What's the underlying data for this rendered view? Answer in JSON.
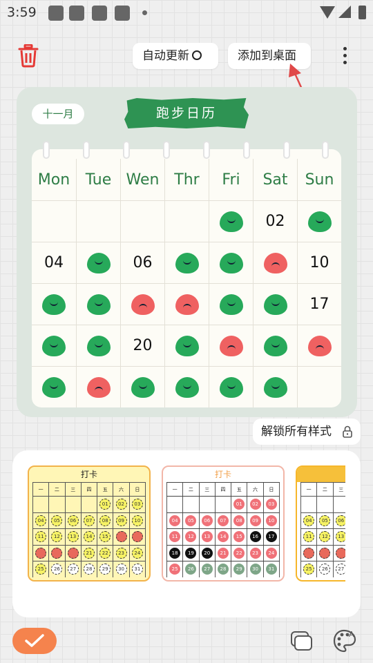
{
  "status_bar": {
    "time": "3:59"
  },
  "toolbar": {
    "auto_update_label": "自动更新",
    "add_to_desktop_label": "添加到桌面"
  },
  "widget": {
    "month_label": "十一月",
    "title": "跑步日历",
    "weekdays": [
      "Mon",
      "Tue",
      "Wen",
      "Thr",
      "Fri",
      "Sat",
      "Sun"
    ],
    "weeks": [
      [
        {
          "type": "empty"
        },
        {
          "type": "empty"
        },
        {
          "type": "empty"
        },
        {
          "type": "empty"
        },
        {
          "type": "green"
        },
        {
          "type": "text",
          "text": "02"
        },
        {
          "type": "green"
        }
      ],
      [
        {
          "type": "text",
          "text": "04"
        },
        {
          "type": "green"
        },
        {
          "type": "text",
          "text": "06"
        },
        {
          "type": "green"
        },
        {
          "type": "green"
        },
        {
          "type": "red"
        },
        {
          "type": "text",
          "text": "10"
        }
      ],
      [
        {
          "type": "green"
        },
        {
          "type": "green"
        },
        {
          "type": "red"
        },
        {
          "type": "red"
        },
        {
          "type": "green"
        },
        {
          "type": "green"
        },
        {
          "type": "text",
          "text": "17"
        }
      ],
      [
        {
          "type": "green"
        },
        {
          "type": "green"
        },
        {
          "type": "text",
          "text": "20"
        },
        {
          "type": "green"
        },
        {
          "type": "red"
        },
        {
          "type": "green"
        },
        {
          "type": "red"
        }
      ],
      [
        {
          "type": "green"
        },
        {
          "type": "red"
        },
        {
          "type": "green"
        },
        {
          "type": "green"
        },
        {
          "type": "green"
        },
        {
          "type": "green"
        },
        {
          "type": "empty"
        }
      ]
    ]
  },
  "unlock_label": "解锁所有样式",
  "styles": {
    "thumb1": {
      "title": "打卡",
      "weekdays": [
        "一",
        "二",
        "三",
        "四",
        "五",
        "六",
        "日"
      ],
      "rows": [
        [
          {
            "t": "",
            "k": "none"
          },
          {
            "t": "",
            "k": "none"
          },
          {
            "t": "",
            "k": "none"
          },
          {
            "t": "",
            "k": "none"
          },
          {
            "t": "01",
            "k": "y"
          },
          {
            "t": "02",
            "k": "y"
          },
          {
            "t": "03",
            "k": "y"
          }
        ],
        [
          {
            "t": "04",
            "k": "y"
          },
          {
            "t": "05",
            "k": "y"
          },
          {
            "t": "06",
            "k": "y"
          },
          {
            "t": "07",
            "k": "y"
          },
          {
            "t": "08",
            "k": "y"
          },
          {
            "t": "09",
            "k": "y"
          },
          {
            "t": "10",
            "k": "y"
          }
        ],
        [
          {
            "t": "11",
            "k": "y"
          },
          {
            "t": "12",
            "k": "y"
          },
          {
            "t": "13",
            "k": "y"
          },
          {
            "t": "14",
            "k": "y"
          },
          {
            "t": "15",
            "k": "y"
          },
          {
            "t": "",
            "k": "red"
          },
          {
            "t": "",
            "k": "red"
          }
        ],
        [
          {
            "t": "",
            "k": "red"
          },
          {
            "t": "",
            "k": "red"
          },
          {
            "t": "",
            "k": "red"
          },
          {
            "t": "21",
            "k": "y"
          },
          {
            "t": "22",
            "k": "y"
          },
          {
            "t": "23",
            "k": "y"
          },
          {
            "t": "24",
            "k": "y"
          }
        ],
        [
          {
            "t": "25",
            "k": "y"
          },
          {
            "t": "26",
            "k": "empty"
          },
          {
            "t": "27",
            "k": "empty"
          },
          {
            "t": "28",
            "k": "empty"
          },
          {
            "t": "29",
            "k": "empty"
          },
          {
            "t": "30",
            "k": "empty"
          },
          {
            "t": "31",
            "k": "empty"
          }
        ]
      ]
    },
    "thumb2": {
      "title": "打卡",
      "weekdays": [
        "一",
        "二",
        "三",
        "四",
        "五",
        "六",
        "日"
      ],
      "rows": [
        [
          {
            "t": "",
            "k": "none"
          },
          {
            "t": "",
            "k": "none"
          },
          {
            "t": "",
            "k": "none"
          },
          {
            "t": "",
            "k": "none"
          },
          {
            "t": "01",
            "k": "pink"
          },
          {
            "t": "02",
            "k": "pink"
          },
          {
            "t": "03",
            "k": "pink"
          }
        ],
        [
          {
            "t": "04",
            "k": "pink"
          },
          {
            "t": "05",
            "k": "pink"
          },
          {
            "t": "06",
            "k": "pink"
          },
          {
            "t": "07",
            "k": "pink"
          },
          {
            "t": "08",
            "k": "pink"
          },
          {
            "t": "09",
            "k": "pink"
          },
          {
            "t": "10",
            "k": "pink"
          }
        ],
        [
          {
            "t": "11",
            "k": "pink"
          },
          {
            "t": "12",
            "k": "pink"
          },
          {
            "t": "13",
            "k": "pink"
          },
          {
            "t": "14",
            "k": "pink"
          },
          {
            "t": "15",
            "k": "pink"
          },
          {
            "t": "16",
            "k": "black"
          },
          {
            "t": "17",
            "k": "black"
          }
        ],
        [
          {
            "t": "18",
            "k": "black"
          },
          {
            "t": "19",
            "k": "black"
          },
          {
            "t": "20",
            "k": "black"
          },
          {
            "t": "21",
            "k": "pink"
          },
          {
            "t": "22",
            "k": "pink"
          },
          {
            "t": "23",
            "k": "pink"
          },
          {
            "t": "24",
            "k": "pink"
          }
        ],
        [
          {
            "t": "25",
            "k": "pink"
          },
          {
            "t": "26",
            "k": "sage"
          },
          {
            "t": "27",
            "k": "sage"
          },
          {
            "t": "28",
            "k": "sage"
          },
          {
            "t": "29",
            "k": "sage"
          },
          {
            "t": "30",
            "k": "sage"
          },
          {
            "t": "31",
            "k": "sage"
          }
        ]
      ]
    },
    "thumb3": {
      "title": "",
      "weekdays": [
        "一",
        "二",
        "三",
        "",
        "",
        "",
        ""
      ],
      "rows": [
        [
          {
            "t": "",
            "k": "none"
          },
          {
            "t": "",
            "k": "none"
          },
          {
            "t": "",
            "k": "none"
          },
          {
            "t": "",
            "k": "none"
          },
          {
            "t": "",
            "k": "none"
          },
          {
            "t": "",
            "k": "none"
          },
          {
            "t": "",
            "k": "none"
          }
        ],
        [
          {
            "t": "04",
            "k": "y"
          },
          {
            "t": "05",
            "k": "y"
          },
          {
            "t": "06",
            "k": "y"
          },
          {
            "t": "",
            "k": "none"
          },
          {
            "t": "",
            "k": "none"
          },
          {
            "t": "",
            "k": "none"
          },
          {
            "t": "",
            "k": "none"
          }
        ],
        [
          {
            "t": "11",
            "k": "y"
          },
          {
            "t": "12",
            "k": "y"
          },
          {
            "t": "13",
            "k": "y"
          },
          {
            "t": "",
            "k": "none"
          },
          {
            "t": "",
            "k": "none"
          },
          {
            "t": "",
            "k": "none"
          },
          {
            "t": "",
            "k": "none"
          }
        ],
        [
          {
            "t": "",
            "k": "red"
          },
          {
            "t": "",
            "k": "red"
          },
          {
            "t": "",
            "k": "red"
          },
          {
            "t": "",
            "k": "none"
          },
          {
            "t": "",
            "k": "none"
          },
          {
            "t": "",
            "k": "none"
          },
          {
            "t": "",
            "k": "none"
          }
        ],
        [
          {
            "t": "25",
            "k": "y"
          },
          {
            "t": "26",
            "k": "empty"
          },
          {
            "t": "27",
            "k": "empty"
          },
          {
            "t": "",
            "k": "none"
          },
          {
            "t": "",
            "k": "none"
          },
          {
            "t": "",
            "k": "none"
          },
          {
            "t": "",
            "k": "none"
          }
        ]
      ]
    }
  },
  "icons": {
    "trash": "trash-icon",
    "more": "more-vertical-icon",
    "lock": "lock-icon",
    "confirm": "check-icon",
    "layers": "layers-icon",
    "palette": "palette-icon"
  },
  "colors": {
    "accent_green": "#2e9353",
    "confirm_orange": "#f5834d",
    "arrow_red": "#e04848"
  }
}
